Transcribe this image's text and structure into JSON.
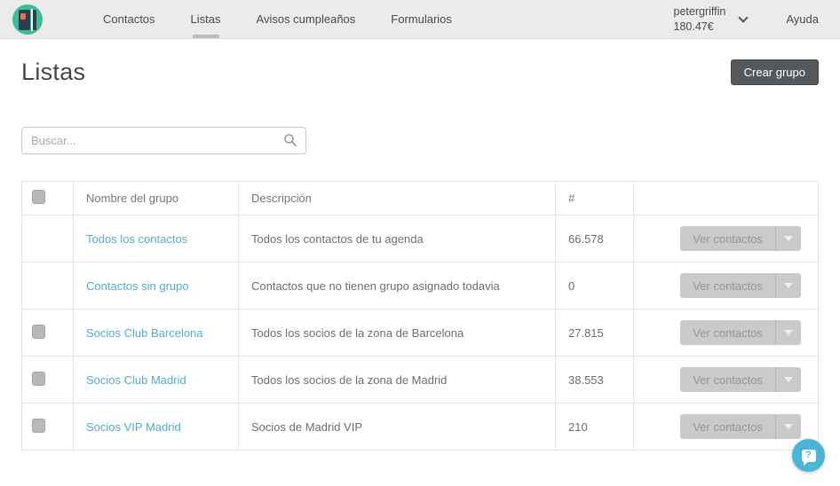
{
  "header": {
    "nav": [
      {
        "label": "Contactos",
        "active": false
      },
      {
        "label": "Listas",
        "active": true
      },
      {
        "label": "Avisos cumpleaños",
        "active": false
      },
      {
        "label": "Formularios",
        "active": false
      }
    ],
    "user": {
      "name": "petergriffin",
      "balance": "180.47€"
    },
    "help_label": "Ayuda"
  },
  "page": {
    "title": "Listas",
    "create_group_button": "Crear grupo"
  },
  "search": {
    "placeholder": "Buscar..."
  },
  "table": {
    "headers": {
      "name": "Nombre del grupo",
      "description": "Descripción",
      "count": "#"
    },
    "action_button": "Ver contactos",
    "rows": [
      {
        "name": "Todos los contactos",
        "description": "Todos los contactos de tu agenda",
        "count": "66.578"
      },
      {
        "name": "Contactos sin grupo",
        "description": "Contactos que no tienen grupo asignado todavia",
        "count": "0"
      },
      {
        "name": "Socios Club Barcelona",
        "description": "Todos los socios de la zona de Barcelona",
        "count": "27.815"
      },
      {
        "name": "Socios Club Madrid",
        "description": "Todos los socios de la zona de Madrid",
        "count": "38.553"
      },
      {
        "name": "Socios VIP Madrid",
        "description": "Socios de Madrid VIP",
        "count": "210"
      }
    ]
  },
  "chat": {
    "glyph": "?"
  },
  "colors": {
    "brand_teal": "#3cbc98",
    "brand_navy": "#2e3d4f",
    "brand_orange": "#e8734a",
    "link_blue": "#55aed0",
    "dark_button": "#55585b",
    "chat_blue": "#4ab5d7",
    "header_bg": "#ebebeb"
  }
}
